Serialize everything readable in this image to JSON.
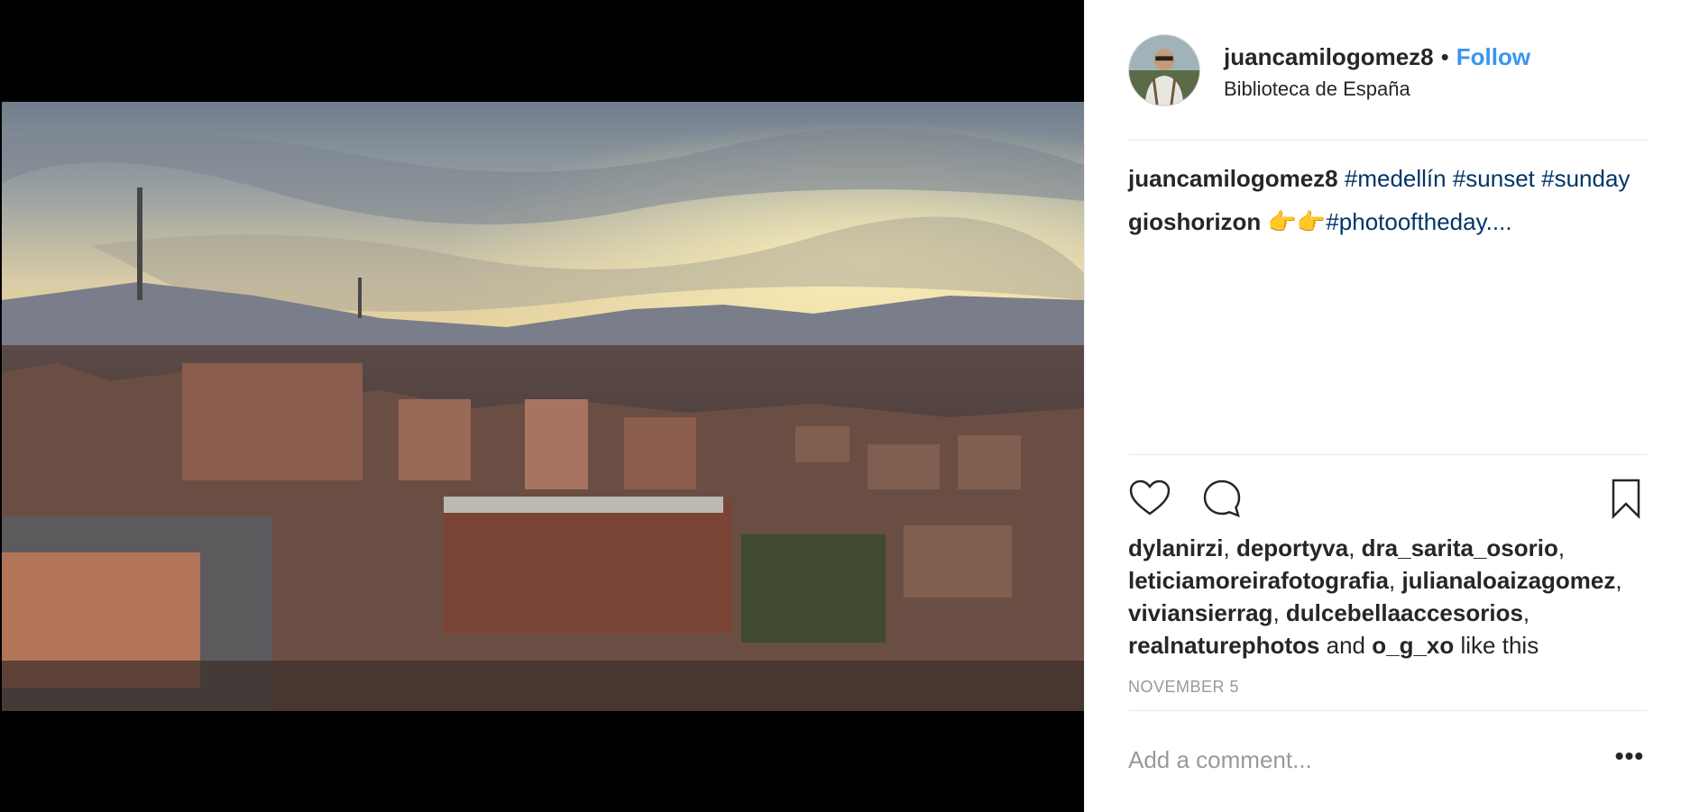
{
  "post": {
    "username": "juancamilogomez8",
    "separator": "•",
    "follow_label": "Follow",
    "location": "Biblioteca de España",
    "caption": {
      "username": "juancamilogomez8",
      "hashtags": [
        "#medellín",
        "#sunset",
        "#sunday"
      ]
    },
    "comment": {
      "username": "gioshorizon",
      "emoji": "👉👉",
      "text": "#photooftheday...."
    },
    "likes": {
      "users": [
        "dylanirzi",
        "deportyva",
        "dra_sarita_osorio",
        "leticiamoreirafotografia",
        "julianaloaizagomez",
        "viviansierrag",
        "dulcebellaaccesorios",
        "realnaturephotos",
        "o_g_xo"
      ],
      "and_word": "and",
      "suffix": "like this"
    },
    "date": "NOVEMBER 5",
    "comment_placeholder": "Add a comment...",
    "more_label": "•••"
  },
  "icons": {
    "like": "heart-icon",
    "comment": "comment-icon",
    "save": "bookmark-icon",
    "more": "more-options-icon"
  },
  "colors": {
    "follow": "#3897f0",
    "hashtag": "#003569",
    "muted": "#999999",
    "text": "#262626"
  }
}
